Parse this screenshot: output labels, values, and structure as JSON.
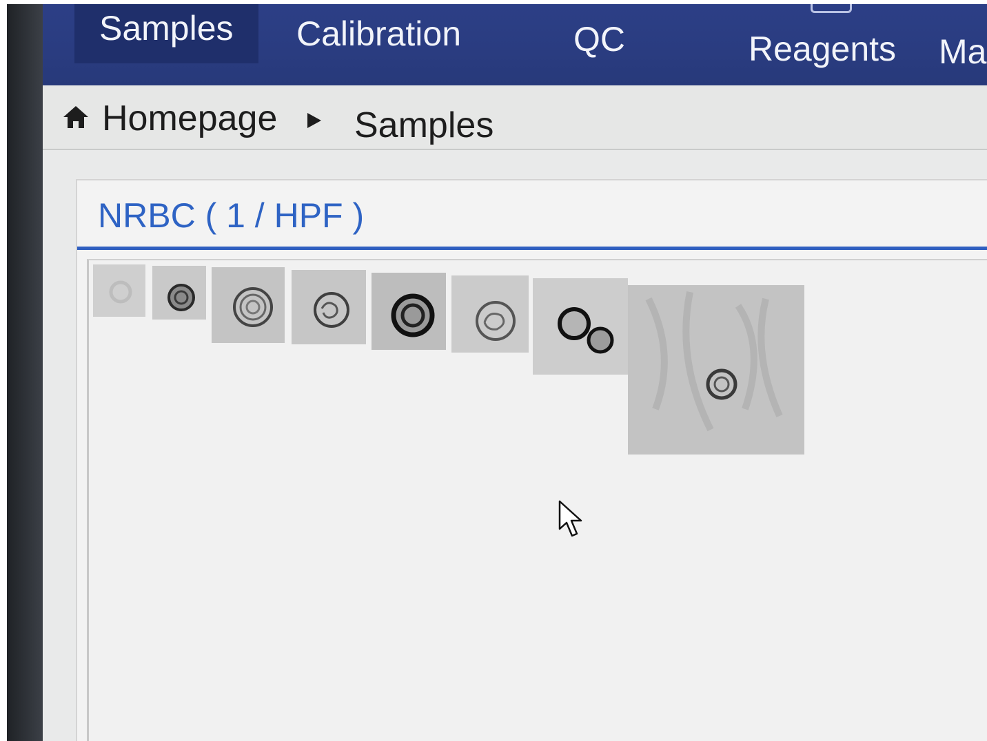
{
  "nav": {
    "tabs": [
      {
        "label": "Samples",
        "active": true
      },
      {
        "label": "Calibration",
        "active": false
      },
      {
        "label": "QC",
        "active": false
      },
      {
        "label": "Reagents",
        "active": false
      },
      {
        "label": "Ma",
        "active": false
      }
    ]
  },
  "breadcrumb": {
    "home_icon": "home-icon",
    "home": "Homepage",
    "separator_icon": "triangle-right-icon",
    "current": "Samples"
  },
  "panel": {
    "title": "NRBC ( 1 / HPF )",
    "cell_image_count": 8
  },
  "colors": {
    "nav_background": "#2a3c80",
    "nav_active": "#1f2f6b",
    "title_blue": "#2e63c4",
    "panel_background": "#f3f3f3"
  }
}
